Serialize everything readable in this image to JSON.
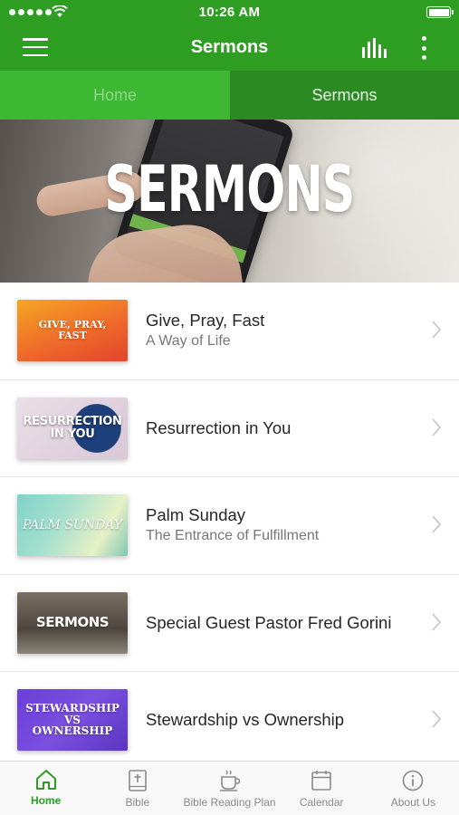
{
  "status_bar": {
    "time": "10:26 AM"
  },
  "nav": {
    "title": "Sermons"
  },
  "tabs": [
    {
      "label": "Home",
      "selected": false
    },
    {
      "label": "Sermons",
      "selected": true
    }
  ],
  "hero": {
    "title": "SERMONS"
  },
  "sermons": [
    {
      "title": "Give, Pray, Fast",
      "subtitle": "A Way of Life",
      "thumb_text": "GIVE, PRAY, FAST"
    },
    {
      "title": "Resurrection in You",
      "subtitle": "",
      "thumb_text": "RESURRECTION IN YOU"
    },
    {
      "title": "Palm Sunday",
      "subtitle": "The Entrance of Fulfillment",
      "thumb_text": "PALM SUNDAY"
    },
    {
      "title": "Special Guest Pastor Fred Gorini",
      "subtitle": "",
      "thumb_text": "SERMONS"
    },
    {
      "title": "Stewardship vs Ownership",
      "subtitle": "",
      "thumb_text": "STEWARDSHIP VS OWNERSHIP"
    }
  ],
  "bottom_tabs": [
    {
      "label": "Home",
      "icon": "home-icon",
      "active": true
    },
    {
      "label": "Bible",
      "icon": "bible-icon",
      "active": false
    },
    {
      "label": "Bible Reading Plan",
      "icon": "coffee-cup-icon",
      "active": false
    },
    {
      "label": "Calendar",
      "icon": "calendar-icon",
      "active": false
    },
    {
      "label": "About Us",
      "icon": "info-icon",
      "active": false
    }
  ],
  "colors": {
    "brand_green": "#2e9e22",
    "tab_inactive_green": "#3db832",
    "tab_active_green": "#2b8a22",
    "active_tab_label": "#2e9e22",
    "inactive_tab_label": "#8a8a8a"
  }
}
